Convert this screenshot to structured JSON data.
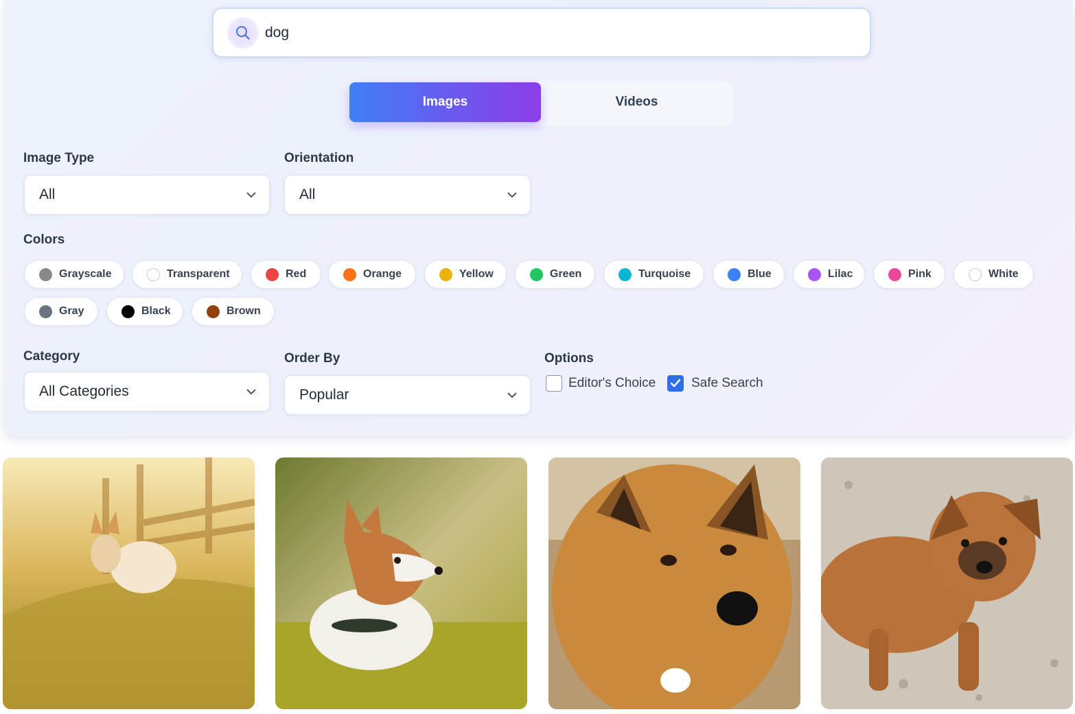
{
  "search": {
    "value": "dog",
    "icon": "search-icon"
  },
  "tabs": [
    {
      "label": "Images",
      "active": true
    },
    {
      "label": "Videos",
      "active": false
    }
  ],
  "filters": {
    "image_type": {
      "label": "Image Type",
      "value": "All"
    },
    "orientation": {
      "label": "Orientation",
      "value": "All"
    },
    "category": {
      "label": "Category",
      "value": "All Categories"
    },
    "order_by": {
      "label": "Order By",
      "value": "Popular"
    }
  },
  "colors": {
    "label": "Colors",
    "items": [
      {
        "label": "Grayscale",
        "color": "#888888"
      },
      {
        "label": "Transparent",
        "color": "#ffffff"
      },
      {
        "label": "Red",
        "color": "#ef4444"
      },
      {
        "label": "Orange",
        "color": "#f97316"
      },
      {
        "label": "Yellow",
        "color": "#eab308"
      },
      {
        "label": "Green",
        "color": "#22c55e"
      },
      {
        "label": "Turquoise",
        "color": "#06b6d4"
      },
      {
        "label": "Blue",
        "color": "#3b82f6"
      },
      {
        "label": "Lilac",
        "color": "#a855f7"
      },
      {
        "label": "Pink",
        "color": "#ec4899"
      },
      {
        "label": "White",
        "color": "#ffffff"
      },
      {
        "label": "Gray",
        "color": "#6b7280"
      },
      {
        "label": "Black",
        "color": "#000000"
      },
      {
        "label": "Brown",
        "color": "#92400e"
      }
    ]
  },
  "options": {
    "label": "Options",
    "editors_choice": {
      "label": "Editor's Choice",
      "checked": false
    },
    "safe_search": {
      "label": "Safe Search",
      "checked": true
    }
  },
  "theme": {
    "accent_start": "#3f7ff5",
    "accent_end": "#8c3ee8",
    "checkbox": "#2f6fe6"
  },
  "results": [
    {
      "subject": "corgi-in-golden-field"
    },
    {
      "subject": "corgi-lying-in-grass"
    },
    {
      "subject": "fluffy-brown-dog"
    },
    {
      "subject": "brown-puppy"
    }
  ]
}
